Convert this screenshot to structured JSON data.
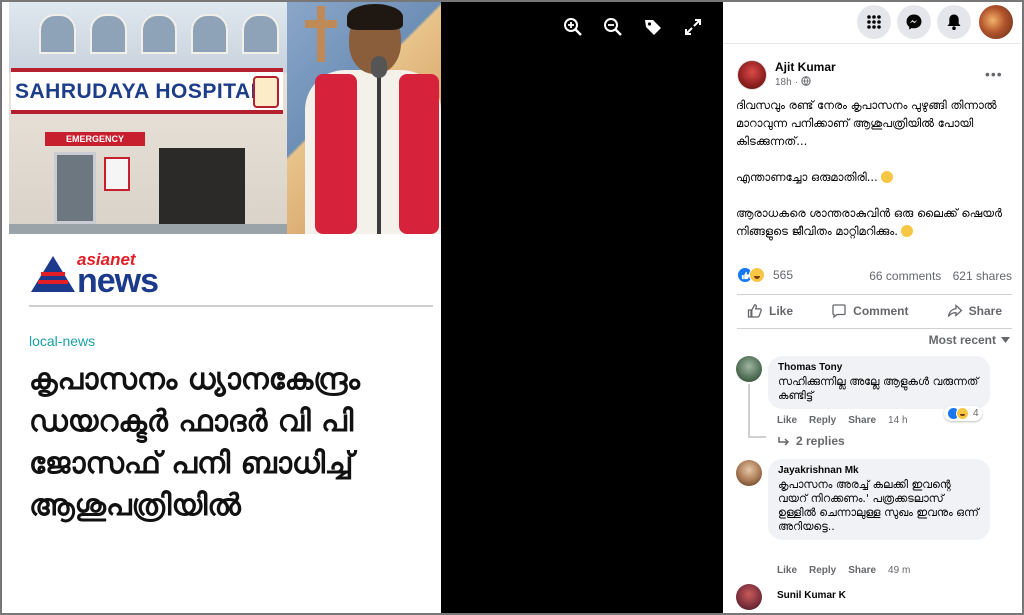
{
  "viewer": {
    "tools": [
      {
        "name": "zoom-in-icon"
      },
      {
        "name": "zoom-out-icon"
      },
      {
        "name": "tag-icon"
      },
      {
        "name": "fullscreen-icon"
      }
    ],
    "article": {
      "hospital_sign": "SAHRUDAYA HOSPITAL",
      "emergency_sign": "EMERGENCY",
      "logo_top": "asianet",
      "logo_main": "news",
      "tag": "local-news",
      "headline": "കൃപാസനം ധ്യാനകേന്ദ്രം ഡയറക്ടർ ഫാദർ വി പി ജോസഫ് പനി ബാധിച്ച് ആശുപത്രിയിൽ"
    }
  },
  "topbar": {
    "buttons": [
      "menu-grid-icon",
      "messenger-icon",
      "notifications-bell-icon"
    ]
  },
  "post": {
    "author": "Ajit Kumar",
    "time": "18h",
    "audience": "public-globe-icon",
    "paragraphs": [
      "ദിവസവും രണ്ട് നേരം കൃപാസനം പുഴുങ്ങി തിന്നാൽ മാറാവുന്ന പനിക്കാണ് ആശുപത്രിയിൽ പോയി കിടക്കുന്നത്...",
      "എന്താണച്ചോ ഒരുമാതിരി...",
      "ആരാധകരെ ശാന്തരാകുവിൻ ഒരു ലൈക്ക് ഷെയർ നിങ്ങളുടെ ജീവിതം മാറ്റിമറിക്കും."
    ],
    "reaction_count": "565",
    "comments_count": "66 comments",
    "shares_count": "621 shares",
    "actions": {
      "like": "Like",
      "comment": "Comment",
      "share": "Share"
    },
    "sort_label": "Most recent"
  },
  "comments": [
    {
      "name": "Thomas Tony",
      "text": "സഹിക്കുന്നില്ല അല്ലേ ആളുകൾ വരുന്നത് കണ്ടിട്ട്",
      "like": "Like",
      "reply": "Reply",
      "share": "Share",
      "time": "14 h",
      "reactions": "4",
      "replies": "2 replies"
    },
    {
      "name": "Jayakrishnan Mk",
      "text": "കൃപാസനം അരച്ച് കലക്കി ഇവന്റെ വയറ് നിറക്കണം.' പത്രക്കടലാസ് ഉള്ളിൽ ചെന്നാലുള്ള സുഖം ഇവനും ഒന്ന് അറിയട്ടെ..",
      "like": "Like",
      "reply": "Reply",
      "share": "Share",
      "time": "49 m"
    },
    {
      "name": "Sunil Kumar K"
    }
  ],
  "colors": {
    "accent": "#1877f2",
    "secondary_text": "#65676b",
    "bubble": "#f0f2f5"
  }
}
